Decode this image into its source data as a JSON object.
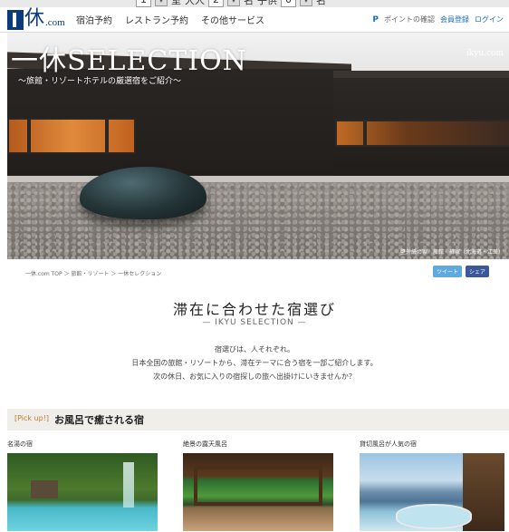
{
  "search_strip": {
    "rooms_value": "1",
    "rooms_unit": "室",
    "adults_label": "大人",
    "adults_value": "2",
    "adults_unit": "名",
    "children_label": "子供",
    "children_value": "0",
    "children_unit": "名"
  },
  "header": {
    "logo_kanji": "休",
    "logo_suffix": ".com",
    "nav": [
      "宿泊予約",
      "レストラン予約",
      "その他サービス"
    ],
    "points_label": "ポイントの確認",
    "register_label": "会員登録",
    "login_label": "ログイン"
  },
  "hero": {
    "title": "一休SELECTION",
    "subtitle": "～旅館・リゾートホテルの厳選宿をご紹介～",
    "watermark": "ikyu.com",
    "caption": "壁外紙の家　旅館　蘇家（北海道・江差）"
  },
  "breadcrumb": "一休.com TOP ＞ 旅館・リゾート ＞ 一休セレクション",
  "share": {
    "tweet_label": "ツイート",
    "share_label": "シェア"
  },
  "section": {
    "title": "滞在に合わせた宿選び",
    "subtitle": "— IKYU SELECTION —",
    "intro": [
      "宿選びは、人それぞれ。",
      "日本全国の旅館・リゾートから、滞在テーマに合う宿を一部ご紹介します。",
      "次の休日、お気に入りの宿探しの旅へ出掛けにいきませんか？"
    ]
  },
  "pickup": {
    "tag": "[Pick up!]",
    "title": "お風呂で癒される宿",
    "cards": [
      {
        "title": "名湯の宿"
      },
      {
        "title": "絶景の露天風呂"
      },
      {
        "title": "貸切風呂が人気の宿"
      }
    ]
  },
  "colors": {
    "brand": "#0b3a7d",
    "link": "#1a6fc4",
    "pickup_tag": "#c07a2a",
    "band_bg": "#f0eeeb"
  }
}
